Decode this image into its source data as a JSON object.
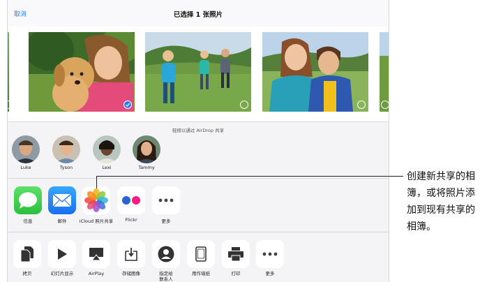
{
  "navbar": {
    "cancel_label": "取消",
    "title": "已选择 1 张照片"
  },
  "photos": [
    {
      "name": "girl-with-puppy",
      "selected": true
    },
    {
      "name": "kids-running",
      "selected": false
    },
    {
      "name": "girl-and-boy",
      "selected": false
    }
  ],
  "airdrop": {
    "caption": "轻按以通过 AirDrop 共享",
    "people": [
      {
        "name": "Luke"
      },
      {
        "name": "Tyson"
      },
      {
        "name": "Lexi"
      },
      {
        "name": "Tammy"
      }
    ]
  },
  "share_apps": [
    {
      "label": "信息",
      "icon": "messages-icon"
    },
    {
      "label": "邮件",
      "icon": "mail-icon"
    },
    {
      "label": "iCloud 照片共享",
      "icon": "photos-icon"
    },
    {
      "label": "Flickr",
      "icon": "flickr-icon"
    },
    {
      "label": "更多",
      "icon": "more-icon"
    }
  ],
  "actions": [
    {
      "label": "拷贝",
      "icon": "copy-icon"
    },
    {
      "label": "幻灯片显示",
      "icon": "play-icon"
    },
    {
      "label": "AirPlay",
      "icon": "airplay-icon"
    },
    {
      "label": "存储图像",
      "icon": "save-image-icon"
    },
    {
      "label": "指定给\n联系人",
      "icon": "contact-icon"
    },
    {
      "label": "用作墙纸",
      "icon": "wallpaper-icon"
    },
    {
      "label": "打印",
      "icon": "print-icon"
    },
    {
      "label": "更多",
      "icon": "more-icon"
    }
  ],
  "callout": {
    "text": "创建新共享的相簿，或将照片添加到现有共享的相簿。"
  },
  "colors": {
    "accent": "#2a7ef0",
    "messages": "#36c74a",
    "mail": "#1e8cf2"
  }
}
